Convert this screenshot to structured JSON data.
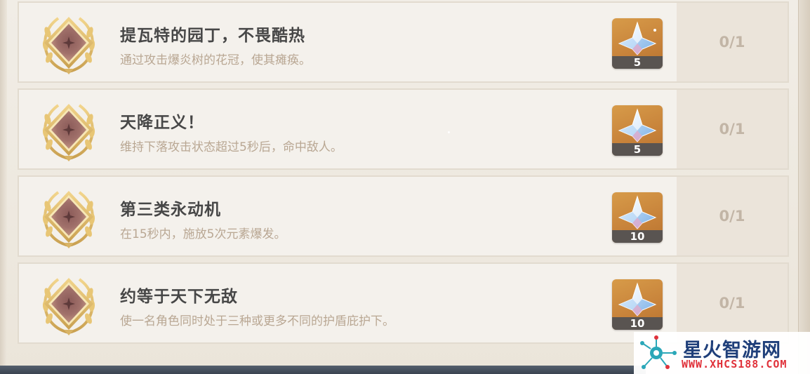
{
  "achievements": [
    {
      "title": "提瓦特的园丁，不畏酷热",
      "description": "通过攻击爆炎树的花冠，使其瘫痪。",
      "reward_icon": "primogem-icon",
      "reward_count": "5",
      "progress": "0/1"
    },
    {
      "title": "天降正义！",
      "description": "维持下落攻击状态超过5秒后，命中敌人。",
      "reward_icon": "primogem-icon",
      "reward_count": "5",
      "progress": "0/1"
    },
    {
      "title": "第三类永动机",
      "description": "在15秒内，施放5次元素爆发。",
      "reward_icon": "primogem-icon",
      "reward_count": "10",
      "progress": "0/1"
    },
    {
      "title": "约等于天下无敌",
      "description": "使一名角色同时处于三种或更多不同的护盾庇护下。",
      "reward_icon": "primogem-icon",
      "reward_count": "10",
      "progress": "0/1"
    }
  ],
  "watermark": {
    "name": "星火智游网",
    "url": "WWW.XHCS188.COM"
  },
  "colors": {
    "row_bg": "#f4f1ec",
    "title": "#474747",
    "description": "#b9a793",
    "progress": "#c2b5a6",
    "reward_bg": "#d08e42",
    "watermark_name": "#1f3f7a",
    "watermark_url": "#e0323b"
  }
}
